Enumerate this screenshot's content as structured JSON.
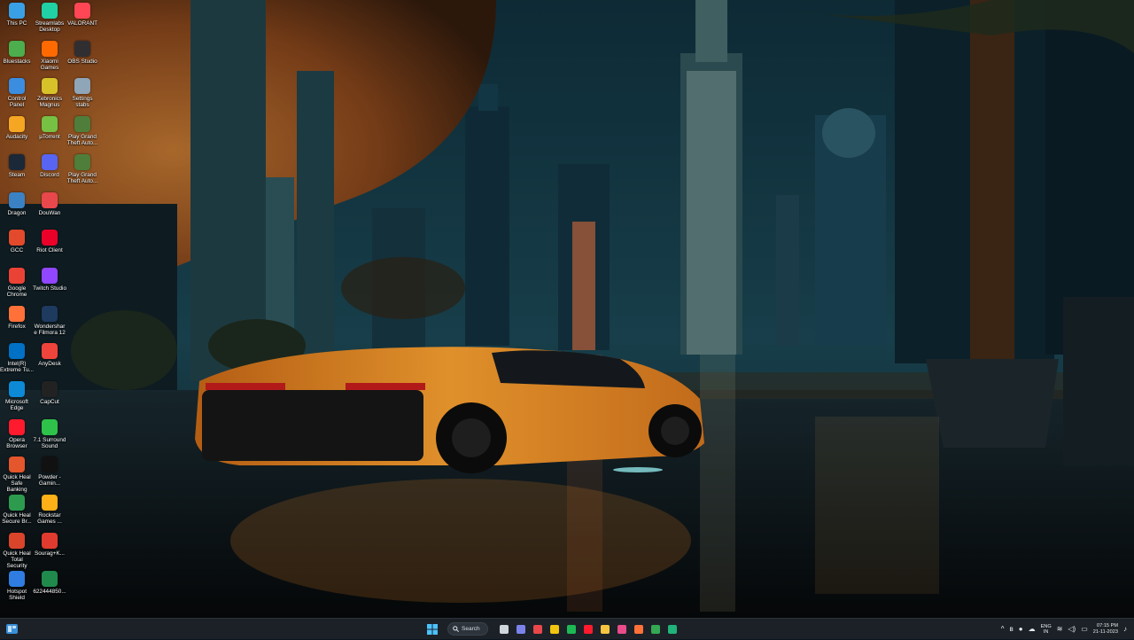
{
  "desktop": {
    "icons": [
      {
        "label": "This PC",
        "icon": "this-pc-icon",
        "color": "#3aa0e6"
      },
      {
        "label": "Streamlabs Desktop",
        "icon": "streamlabs-icon",
        "color": "#1fd1a5"
      },
      {
        "label": "VALORANT",
        "icon": "valorant-icon",
        "color": "#ff4655"
      },
      {
        "label": "Bluestacks",
        "icon": "bluestacks-icon",
        "color": "#4cae4c"
      },
      {
        "label": "Xiaomi Games",
        "icon": "xiaomi-games-icon",
        "color": "#ff6a00"
      },
      {
        "label": "OBS Studio",
        "icon": "obs-icon",
        "color": "#302e31"
      },
      {
        "label": "Control Panel",
        "icon": "control-panel-icon",
        "color": "#3b8de0"
      },
      {
        "label": "Zebronics Magnus",
        "icon": "zebronics-icon",
        "color": "#d7c22a"
      },
      {
        "label": "Settings stabs",
        "icon": "settings-folder-icon",
        "color": "#8fa5b8"
      },
      {
        "label": "Audacity",
        "icon": "audacity-icon",
        "color": "#f5a623"
      },
      {
        "label": "µTorrent",
        "icon": "utorrent-icon",
        "color": "#76c043"
      },
      {
        "label": "Play Grand Theft Auto...",
        "icon": "gta-icon",
        "color": "#4f7d3a"
      },
      {
        "label": "Steam",
        "icon": "steam-icon",
        "color": "#1b2838"
      },
      {
        "label": "Discord",
        "icon": "discord-icon",
        "color": "#5865f2"
      },
      {
        "label": "Play Grand Theft Auto...",
        "icon": "gta-icon",
        "color": "#4f7d3a"
      },
      {
        "label": "Dragon",
        "icon": "dragon-icon",
        "color": "#3b82c4"
      },
      {
        "label": "DouWan",
        "icon": "douwan-icon",
        "color": "#e8474b"
      },
      {
        "label": "GCC",
        "icon": "gcc-icon",
        "color": "#e24a2b"
      },
      {
        "label": "Riot Client",
        "icon": "riot-client-icon",
        "color": "#eb0029"
      },
      {
        "label": "Google Chrome",
        "icon": "chrome-icon",
        "color": "#ea4335"
      },
      {
        "label": "Twitch Studio",
        "icon": "twitch-icon",
        "color": "#9146ff"
      },
      {
        "label": "Firefox",
        "icon": "firefox-icon",
        "color": "#ff7139"
      },
      {
        "label": "Wondershare Filmora 12",
        "icon": "filmora-icon",
        "color": "#1e3a5f"
      },
      {
        "label": "Intel(R) Extreme Tu...",
        "icon": "intel-icon",
        "color": "#0071c5"
      },
      {
        "label": "AnyDesk",
        "icon": "anydesk-icon",
        "color": "#ef443b"
      },
      {
        "label": "Microsoft Edge",
        "icon": "edge-icon",
        "color": "#0c8ad6"
      },
      {
        "label": "CapCut",
        "icon": "capcut-icon",
        "color": "#222222"
      },
      {
        "label": "Opera Browser",
        "icon": "opera-icon",
        "color": "#ff1b2d"
      },
      {
        "label": "7.1 Surround Sound",
        "icon": "surround-sound-icon",
        "color": "#2ec24a"
      },
      {
        "label": "Quick Heal Safe Banking",
        "icon": "quickheal-icon",
        "color": "#e4562c"
      },
      {
        "label": "Powder - Gamin...",
        "icon": "powder-icon",
        "color": "#111111"
      },
      {
        "label": "Quick Heal Secure Br...",
        "icon": "quickheal-browser-icon",
        "color": "#2d9b4e"
      },
      {
        "label": "Rockstar Games ...",
        "icon": "rockstar-icon",
        "color": "#fcaf17"
      },
      {
        "label": "Quick Heal Total Security",
        "icon": "quickheal-total-icon",
        "color": "#d9452b"
      },
      {
        "label": "Sourag+K...",
        "icon": "pdf-file-icon",
        "color": "#e03b2e"
      },
      {
        "label": "Hotspot Shield",
        "icon": "hotspot-shield-icon",
        "color": "#2f7de1"
      },
      {
        "label": "622444850...",
        "icon": "file-icon",
        "color": "#1f8a4c"
      }
    ]
  },
  "taskbar": {
    "search_label": "Search",
    "pinned": [
      {
        "icon": "windows-start-icon",
        "color": "#4cc2ff"
      },
      {
        "icon": "task-view-icon",
        "color": "#cfd6dc"
      },
      {
        "icon": "chat-icon",
        "color": "#7b83eb"
      },
      {
        "icon": "office-icon",
        "color": "#e8474b"
      },
      {
        "icon": "sticky-notes-icon",
        "color": "#f1c40f"
      },
      {
        "icon": "spotify-icon",
        "color": "#1db954"
      },
      {
        "icon": "opera-icon",
        "color": "#ff1b2d"
      },
      {
        "icon": "file-explorer-icon",
        "color": "#f5c542"
      },
      {
        "icon": "filmora-icon",
        "color": "#e94c89"
      },
      {
        "icon": "firefox-icon",
        "color": "#ff7139"
      },
      {
        "icon": "chrome-icon",
        "color": "#34a853"
      },
      {
        "icon": "active-app-icon",
        "color": "#20b47a"
      }
    ],
    "tray": {
      "language_line1": "ENG",
      "language_line2": "IN",
      "time": "07:15 PM",
      "date": "21-11-2023"
    }
  }
}
